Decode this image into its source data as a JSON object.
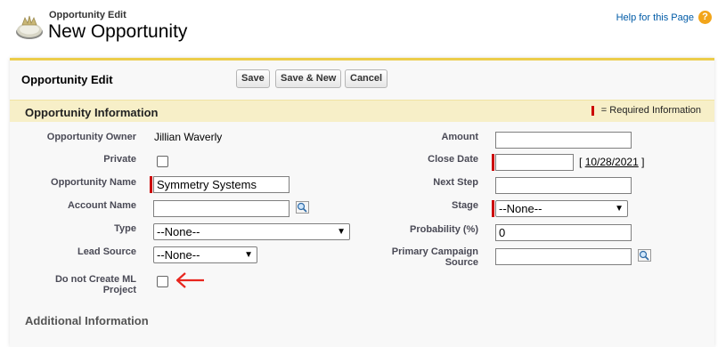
{
  "header": {
    "subtitle": "Opportunity Edit",
    "title": "New Opportunity",
    "help_link": "Help for this Page",
    "help_icon": "?"
  },
  "pageblock": {
    "title": "Opportunity Edit",
    "buttons": {
      "save": "Save",
      "save_new": "Save & New",
      "cancel": "Cancel"
    }
  },
  "section": {
    "title": "Opportunity Information",
    "required_legend": "= Required Information"
  },
  "fields": {
    "owner": {
      "label": "Opportunity Owner",
      "value": "Jillian Waverly"
    },
    "private": {
      "label": "Private"
    },
    "name": {
      "label": "Opportunity Name",
      "value": "Symmetry Systems"
    },
    "account": {
      "label": "Account Name",
      "value": ""
    },
    "type": {
      "label": "Type",
      "value": "--None--"
    },
    "lead_source": {
      "label": "Lead Source",
      "value": "--None--"
    },
    "no_ml": {
      "label_line1": "Do not Create ML",
      "label_line2": "Project"
    },
    "amount": {
      "label": "Amount",
      "value": ""
    },
    "close_date": {
      "label": "Close Date",
      "value": "",
      "today_prefix": "[",
      "today_link": "10/28/2021",
      "today_suffix": "]"
    },
    "next_step": {
      "label": "Next Step",
      "value": ""
    },
    "stage": {
      "label": "Stage",
      "value": "--None--"
    },
    "probability": {
      "label": "Probability (%)",
      "value": "0"
    },
    "campaign": {
      "label_line1": "Primary Campaign",
      "label_line2": "Source",
      "value": ""
    }
  },
  "additional": {
    "title": "Additional Information"
  },
  "colors": {
    "required": "#cc0000",
    "accent": "#eccd4b",
    "section_bg": "#f7efc8",
    "annotation_arrow": "#e8261e"
  }
}
